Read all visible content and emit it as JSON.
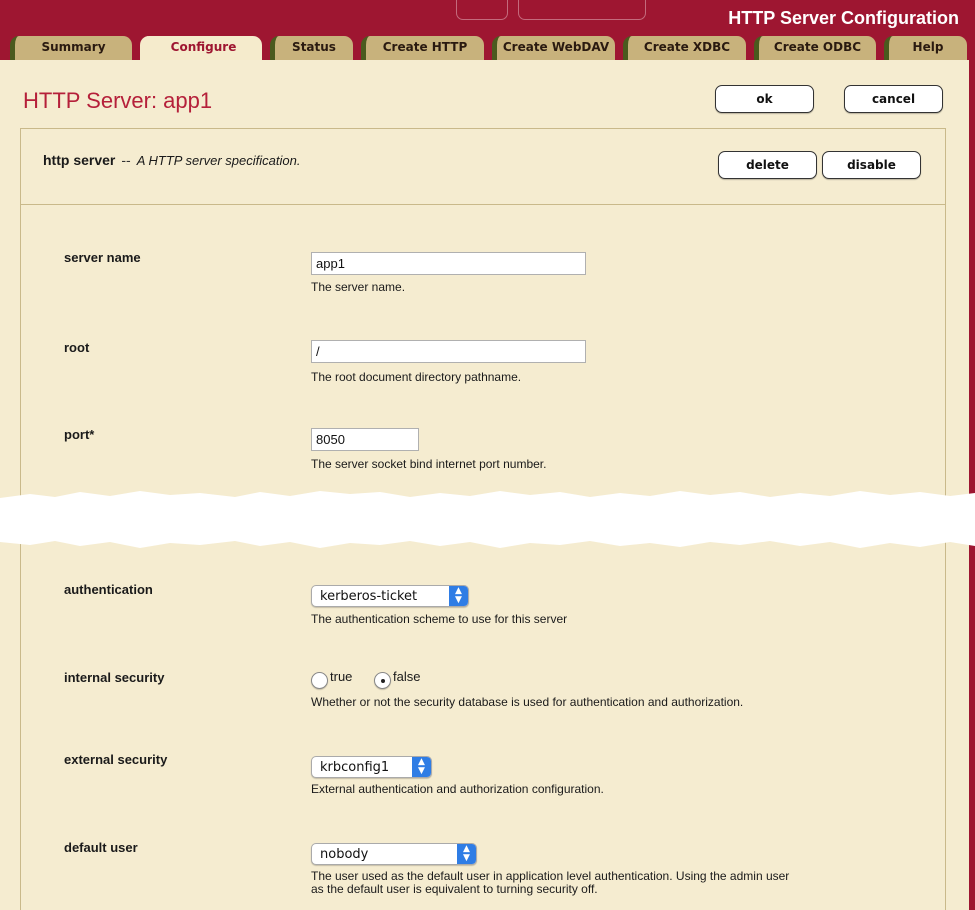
{
  "header": {
    "app_title": "HTTP Server Configuration",
    "tabs": [
      {
        "label": "Summary",
        "active": false
      },
      {
        "label": "Configure",
        "active": true
      },
      {
        "label": "Status",
        "active": false
      },
      {
        "label": "Create HTTP",
        "active": false
      },
      {
        "label": "Create WebDAV",
        "active": false
      },
      {
        "label": "Create XDBC",
        "active": false
      },
      {
        "label": "Create ODBC",
        "active": false
      },
      {
        "label": "Help",
        "active": false
      }
    ]
  },
  "page": {
    "title": "HTTP Server: app1",
    "ok_label": "ok",
    "cancel_label": "cancel"
  },
  "panel": {
    "name": "http server",
    "separator": "--",
    "description": "A HTTP server specification.",
    "delete_label": "delete",
    "disable_label": "disable"
  },
  "fields": {
    "server_name": {
      "label": "server name",
      "value": "app1",
      "description": "The server name."
    },
    "root": {
      "label": "root",
      "value": "/",
      "description": "The root document directory pathname."
    },
    "port": {
      "label": "port*",
      "value": "8050",
      "description": "The server socket bind internet port number."
    },
    "authentication": {
      "label": "authentication",
      "value": "kerberos-ticket",
      "description": "The authentication scheme to use for this server"
    },
    "internal_security": {
      "label": "internal security",
      "option_true": "true",
      "option_false": "false",
      "selected": "false",
      "description": "Whether or not the security database is used for authentication and authorization."
    },
    "external_security": {
      "label": "external security",
      "value": "krbconfig1",
      "description": "External authentication and authorization configuration."
    },
    "default_user": {
      "label": "default user",
      "value": "nobody",
      "description_line1": "The user used as the default user in application level authentication. Using the admin user",
      "description_line2": "as the default user is equivalent to turning security off."
    }
  },
  "colors": {
    "brand": "#9e1631",
    "background": "#f5ecd0",
    "tab_inactive": "#c8b27c",
    "tab_active": "#f5ebcc",
    "select_accent": "#2f7de5"
  }
}
